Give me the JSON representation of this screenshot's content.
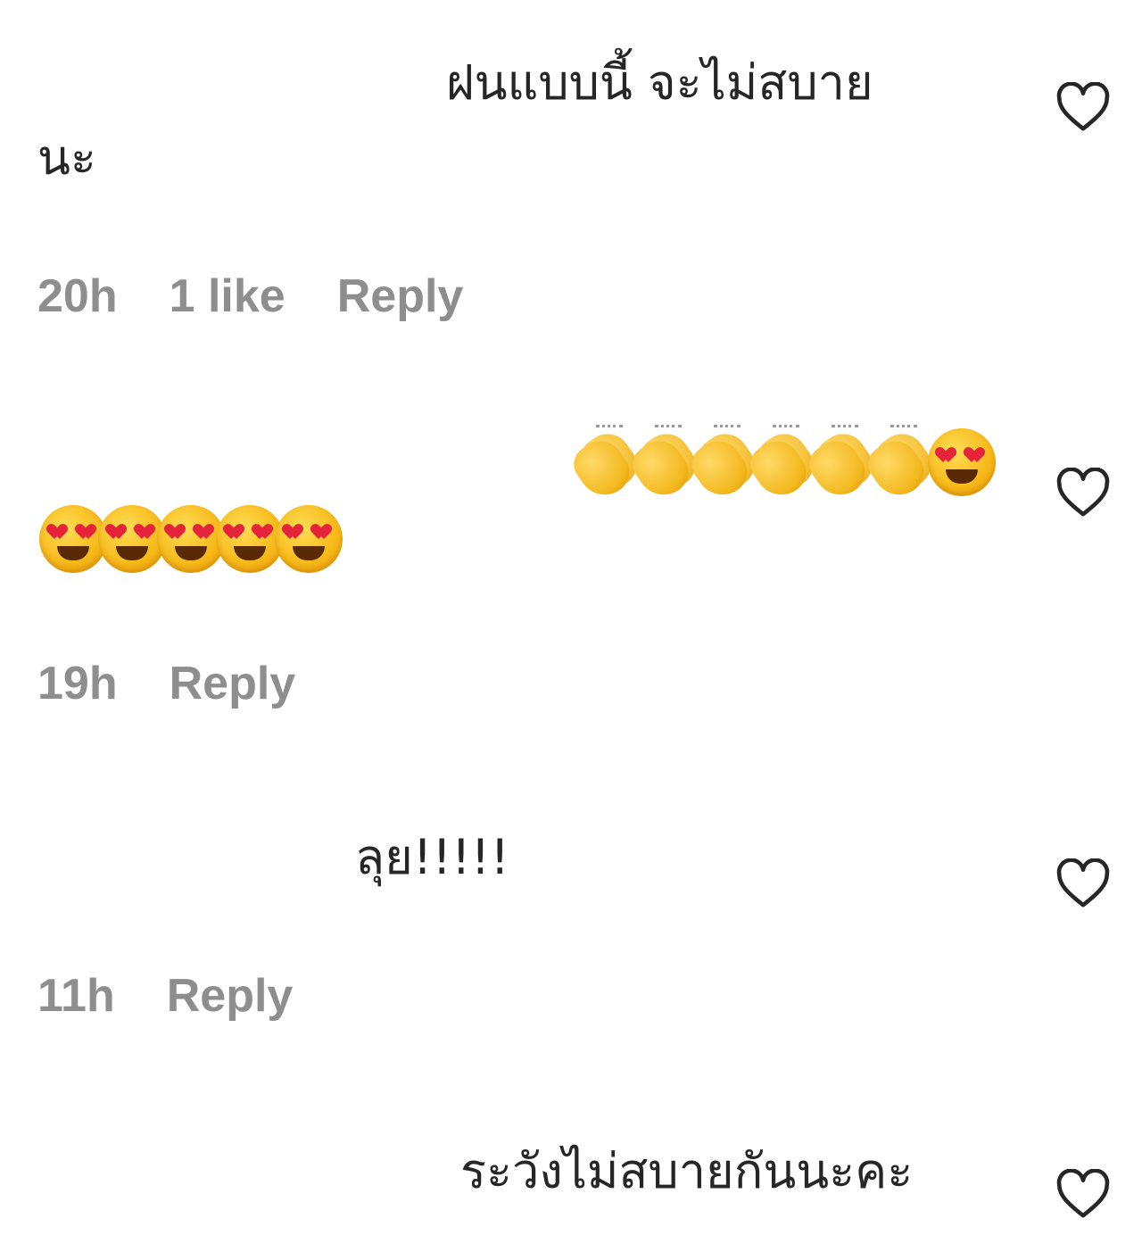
{
  "comments": [
    {
      "text_line1": "ฝนแบบนี้ จะไม่สบาย",
      "text_line2": "นะ",
      "time": "20h",
      "likes": "1 like",
      "reply": "Reply"
    },
    {
      "emoji_line1": [
        "clapping-hands",
        "clapping-hands",
        "clapping-hands",
        "clapping-hands",
        "clapping-hands",
        "clapping-hands",
        "smiling-face-with-heart-eyes"
      ],
      "emoji_line2": [
        "smiling-face-with-heart-eyes",
        "smiling-face-with-heart-eyes",
        "smiling-face-with-heart-eyes",
        "smiling-face-with-heart-eyes",
        "smiling-face-with-heart-eyes"
      ],
      "time": "19h",
      "reply": "Reply"
    },
    {
      "text_line1": "ลุย!!!!!",
      "time": "11h",
      "reply": "Reply"
    },
    {
      "text_line1": "ระวังไม่สบายกันนะคะ"
    }
  ],
  "icons": {
    "like": "heart-outline-icon"
  },
  "colors": {
    "text": "#262626",
    "meta": "#8e8e8e",
    "background": "#ffffff"
  }
}
